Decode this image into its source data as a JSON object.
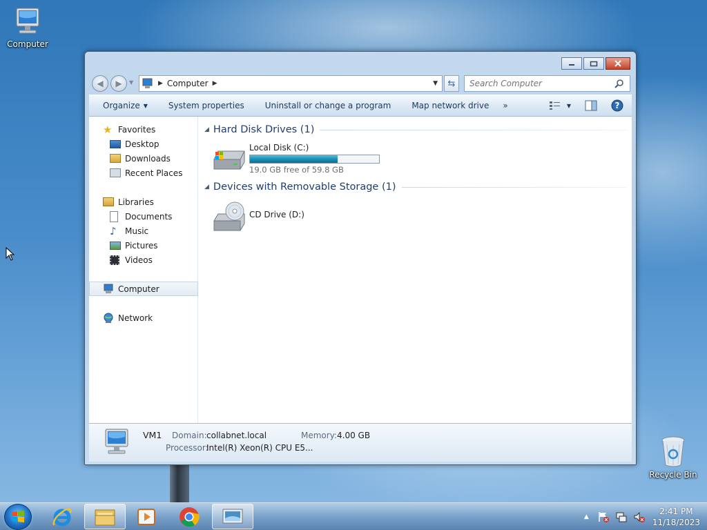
{
  "desktop": {
    "icons": [
      {
        "name": "computer-desktop-icon",
        "label": "Computer"
      },
      {
        "name": "recycle-bin-icon",
        "label": "Recycle Bin"
      }
    ]
  },
  "window": {
    "breadcrumb": [
      "Computer"
    ],
    "search": {
      "placeholder": "Search Computer"
    },
    "toolbar": {
      "organize": "Organize",
      "system_properties": "System properties",
      "uninstall": "Uninstall or change a program",
      "map_network": "Map network drive",
      "more": "»"
    },
    "nav": {
      "favorites": {
        "label": "Favorites",
        "items": [
          "Desktop",
          "Downloads",
          "Recent Places"
        ]
      },
      "libraries": {
        "label": "Libraries",
        "items": [
          "Documents",
          "Music",
          "Pictures",
          "Videos"
        ]
      },
      "computer": "Computer",
      "network": "Network"
    },
    "groups": [
      {
        "title": "Hard Disk Drives (1)",
        "drives": [
          {
            "name": "Local Disk (C:)",
            "free": "19.0 GB free of 59.8 GB",
            "used_fraction": 0.68
          }
        ]
      },
      {
        "title": "Devices with Removable Storage (1)",
        "drives": [
          {
            "name": "CD Drive (D:)"
          }
        ]
      }
    ],
    "details": {
      "name": "VM1",
      "domain_label": "Domain:",
      "domain": "collabnet.local",
      "memory_label": "Memory:",
      "memory": "4.00 GB",
      "processor_label": "Processor:",
      "processor": "Intel(R) Xeon(R) CPU E5..."
    }
  },
  "taskbar": {
    "time": "2:41 PM",
    "date": "11/18/2023"
  },
  "colors": {
    "accent": "#1e3d6e",
    "bar_fill": "#1b8fb5"
  }
}
